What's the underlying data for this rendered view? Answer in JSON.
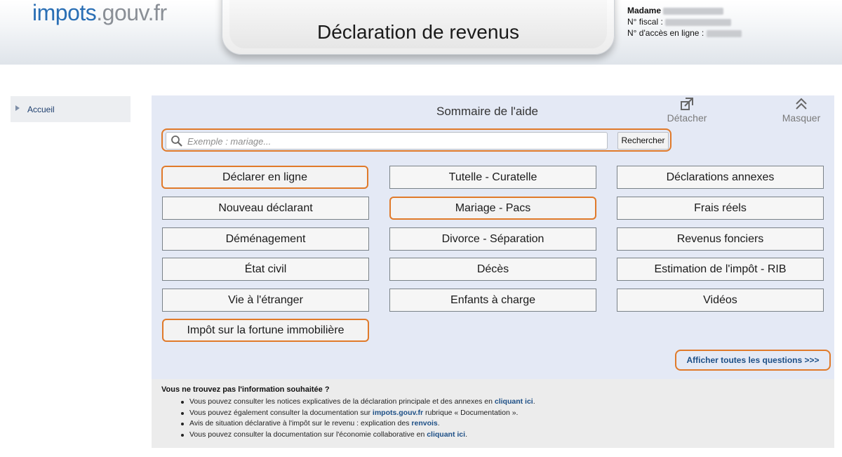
{
  "header": {
    "logo_part1": "impots",
    "logo_part2": ".gouv.fr",
    "title": "Déclaration de revenus",
    "user_title": "Madame",
    "fiscal_label": "N° fiscal :",
    "access_label": "N° d'accès en ligne :"
  },
  "sidebar": {
    "items": [
      {
        "label": "Accueil"
      }
    ]
  },
  "help": {
    "title": "Sommaire de l'aide",
    "detach_label": "Détacher",
    "hide_label": "Masquer",
    "search_placeholder": "Exemple : mariage...",
    "search_button": "Rechercher",
    "topics": [
      {
        "label": "Déclarer en ligne",
        "highlighted": true
      },
      {
        "label": "Tutelle - Curatelle",
        "highlighted": false
      },
      {
        "label": "Déclarations annexes",
        "highlighted": false
      },
      {
        "label": "Nouveau déclarant",
        "highlighted": false
      },
      {
        "label": "Mariage - Pacs",
        "highlighted": true
      },
      {
        "label": "Frais réels",
        "highlighted": false
      },
      {
        "label": "Déménagement",
        "highlighted": false
      },
      {
        "label": "Divorce - Séparation",
        "highlighted": false
      },
      {
        "label": "Revenus fonciers",
        "highlighted": false
      },
      {
        "label": "État civil",
        "highlighted": false
      },
      {
        "label": "Décès",
        "highlighted": false
      },
      {
        "label": "Estimation de l'impôt - RIB",
        "highlighted": false
      },
      {
        "label": "Vie à l'étranger",
        "highlighted": false
      },
      {
        "label": "Enfants à charge",
        "highlighted": false
      },
      {
        "label": "Vidéos",
        "highlighted": false
      },
      {
        "label": "Impôt sur la fortune immobilière",
        "highlighted": true
      }
    ],
    "show_all": "Afficher toutes les questions >>>"
  },
  "info": {
    "question": "Vous ne trouvez pas l'information souhaitée ?",
    "lines": [
      {
        "text": "Vous pouvez consulter les notices explicatives de la déclaration principale et des annexes en ",
        "link": "cliquant ici",
        "after": "."
      },
      {
        "text": "Vous pouvez également consulter la documentation sur ",
        "link": "impots.gouv.fr",
        "after": " rubrique « Documentation »."
      },
      {
        "text": "Avis de situation déclarative à l'impôt sur le revenu : explication des ",
        "link": "renvois",
        "after": "."
      },
      {
        "text": "Vous pouvez consulter la documentation sur l'économie collaborative en ",
        "link": "cliquant ici",
        "after": "."
      }
    ]
  },
  "colors": {
    "highlight": "#e07a2a",
    "panel_bg": "#e4e9f5",
    "link": "#1d4f86"
  }
}
